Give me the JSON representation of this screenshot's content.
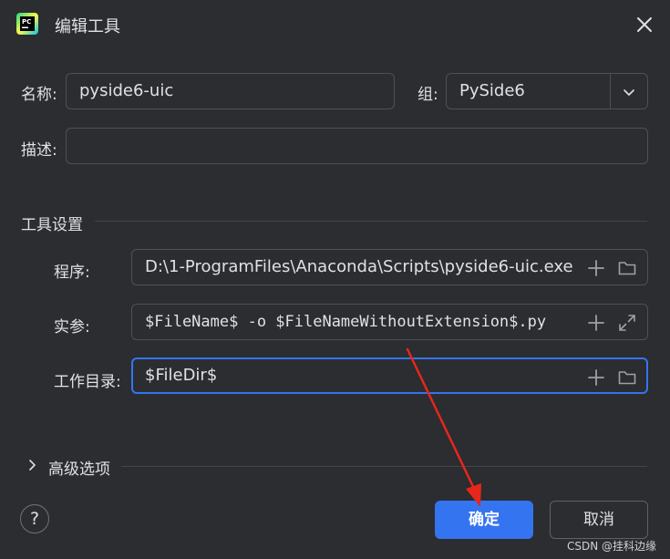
{
  "window": {
    "title": "编辑工具"
  },
  "header": {
    "name_label": "名称:",
    "name_value": "pyside6-uic",
    "group_label": "组:",
    "group_value": "PySide6",
    "description_label": "描述:",
    "description_value": ""
  },
  "tool_settings": {
    "section_title": "工具设置",
    "program_label": "程序:",
    "program_value": "D:\\1-ProgramFiles\\Anaconda\\Scripts\\pyside6-uic.exe",
    "arguments_label": "实参:",
    "arguments_value": "$FileName$ -o $FileNameWithoutExtension$.py",
    "workdir_label": "工作目录:",
    "workdir_value": "$FileDir$"
  },
  "advanced": {
    "label": "高级选项"
  },
  "footer": {
    "help_label": "?",
    "ok_label": "确定",
    "cancel_label": "取消"
  },
  "watermark": "CSDN @挂科边缘",
  "colors": {
    "background": "#2b2d30",
    "accent": "#3574f0",
    "annotation_arrow": "#e8261c"
  },
  "icons": [
    "pycharm-app-icon",
    "close-icon",
    "chevron-down-icon",
    "plus-icon",
    "folder-icon",
    "expand-icon",
    "chevron-right-icon"
  ]
}
